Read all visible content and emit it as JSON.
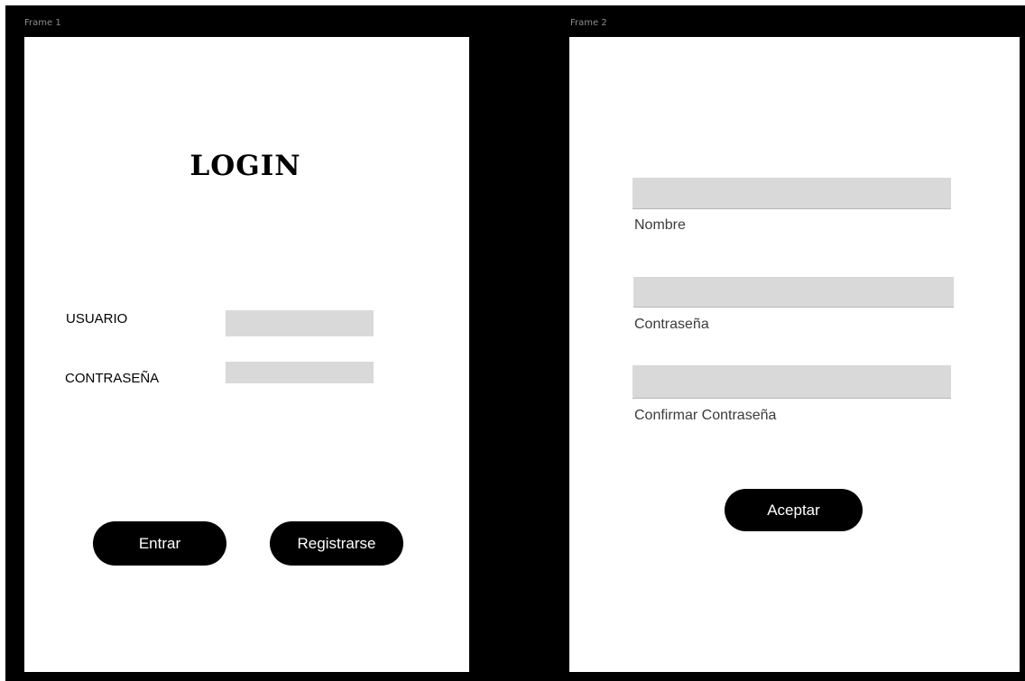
{
  "frames": [
    {
      "label": "Frame 1",
      "title": "LOGIN",
      "fields": [
        {
          "label": "USUARIO",
          "value": "",
          "placeholder": ""
        },
        {
          "label": "CONTRASEÑA",
          "value": "",
          "placeholder": ""
        }
      ],
      "buttons": {
        "enter": "Entrar",
        "register": "Registrarse"
      }
    },
    {
      "label": "Frame 2",
      "fields": [
        {
          "label": "Nombre",
          "value": "",
          "placeholder": ""
        },
        {
          "label": "Contraseña",
          "value": "",
          "placeholder": ""
        },
        {
          "label": "Confirmar Contraseña",
          "value": "",
          "placeholder": ""
        }
      ],
      "buttons": {
        "accept": "Aceptar"
      }
    }
  ],
  "colors": {
    "background": "#000000",
    "frame": "#ffffff",
    "input": "#d9d9d9",
    "button": "#000000",
    "button_text": "#ffffff"
  }
}
